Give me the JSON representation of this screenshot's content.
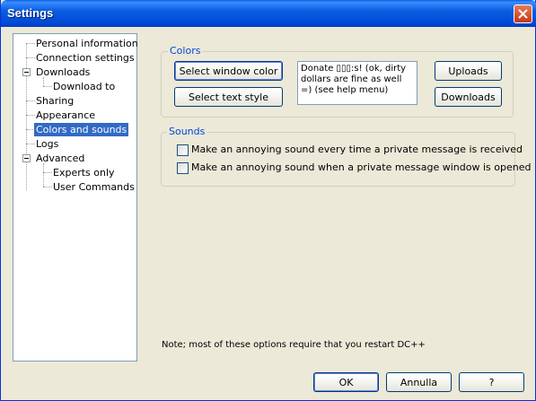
{
  "window": {
    "title": "Settings"
  },
  "tree": {
    "items": [
      {
        "label": "Personal information"
      },
      {
        "label": "Connection settings"
      },
      {
        "label": "Downloads"
      },
      {
        "label": "Download to"
      },
      {
        "label": "Sharing"
      },
      {
        "label": "Appearance"
      },
      {
        "label": "Colors and sounds",
        "selected": true
      },
      {
        "label": "Logs"
      },
      {
        "label": "Advanced"
      },
      {
        "label": "Experts only"
      },
      {
        "label": "User Commands"
      }
    ]
  },
  "colors": {
    "group_label": "Colors",
    "select_window_color": "Select window color",
    "select_text_style": "Select text style",
    "preview_text": "Donate ▯▯▯:s! (ok, dirty dollars are fine as well =) (see help menu)",
    "uploads": "Uploads",
    "downloads": "Downloads"
  },
  "sounds": {
    "group_label": "Sounds",
    "options": [
      {
        "label": "Make an annoying sound every time a private message is received",
        "checked": false
      },
      {
        "label": "Make an annoying sound when a private message window is opened",
        "checked": false
      }
    ]
  },
  "note": "Note; most of these options require that you restart DC++",
  "buttons": {
    "ok": "OK",
    "cancel": "Annulla",
    "help": "?"
  }
}
